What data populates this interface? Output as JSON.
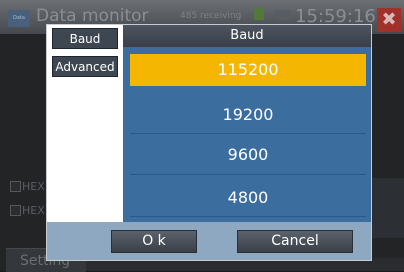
{
  "background": {
    "logo_text": "Data",
    "title": "Data monitor",
    "status_text": "485 receiving",
    "clock": "15:59:16",
    "close_glyph": "✖",
    "checkbox_labels": [
      "HEX",
      "HEX"
    ],
    "bottom_label": "Setting"
  },
  "dialog": {
    "tabs": [
      {
        "label": "Baud"
      },
      {
        "label": "Advanced"
      }
    ],
    "header": "Baud",
    "options": [
      {
        "label": "115200",
        "selected": true
      },
      {
        "label": "19200",
        "selected": false
      },
      {
        "label": "9600",
        "selected": false
      },
      {
        "label": "4800",
        "selected": false
      }
    ],
    "ok_label": "O k",
    "cancel_label": "Cancel"
  },
  "colors": {
    "selected": "#f4b600",
    "list_bg": "#3c6d9f",
    "footer_bg": "#8ea8c2",
    "close": "#a0312b"
  }
}
